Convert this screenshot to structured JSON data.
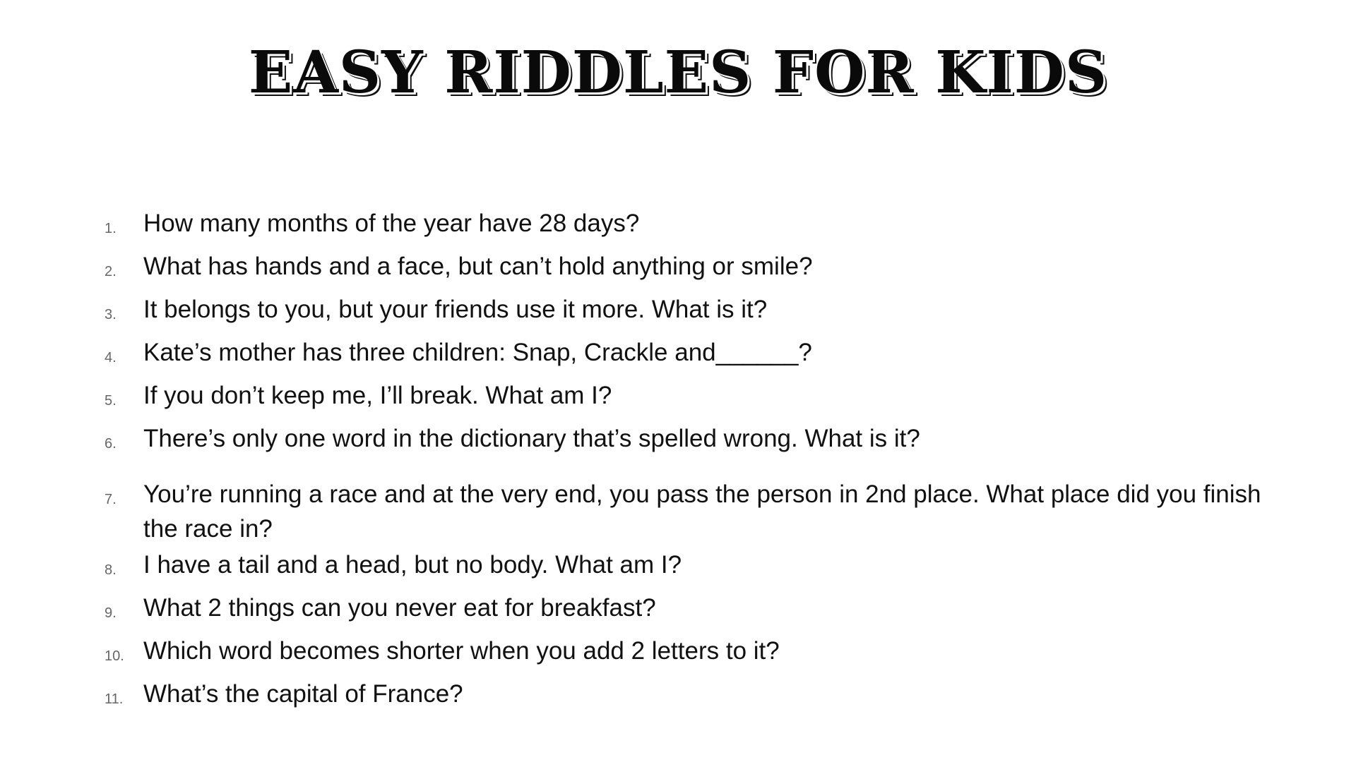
{
  "title": "EASY RIDDLES FOR KIDS",
  "riddles": [
    {
      "number": "1.",
      "text": "How many months of the year have 28 days?"
    },
    {
      "number": "2.",
      "text": "What has hands and a face, but can’t hold anything or smile?"
    },
    {
      "number": "3.",
      "text": "It belongs to you, but your friends use it more. What is it?"
    },
    {
      "number": "4.",
      "text": "Kate’s mother has three children: Snap, Crackle and______?"
    },
    {
      "number": "5.",
      "text": "If you don’t keep me, I’ll break. What am I?"
    },
    {
      "number": "6.",
      "text": "There’s only one word in the dictionary that’s spelled wrong. What is it?"
    },
    {
      "number": "7.",
      "text": "You’re running a race and at the very end, you pass the person in 2nd place. What place did you finish the race in?"
    },
    {
      "number": "8.",
      "text": "I have a tail and a head, but no body. What am I?"
    },
    {
      "number": "9.",
      "text": "What 2 things can you never eat for breakfast?"
    },
    {
      "number": "10.",
      "text": "Which word becomes shorter when you add 2 letters to it?"
    },
    {
      "number": "11.",
      "text": "What’s the capital of France?"
    }
  ]
}
